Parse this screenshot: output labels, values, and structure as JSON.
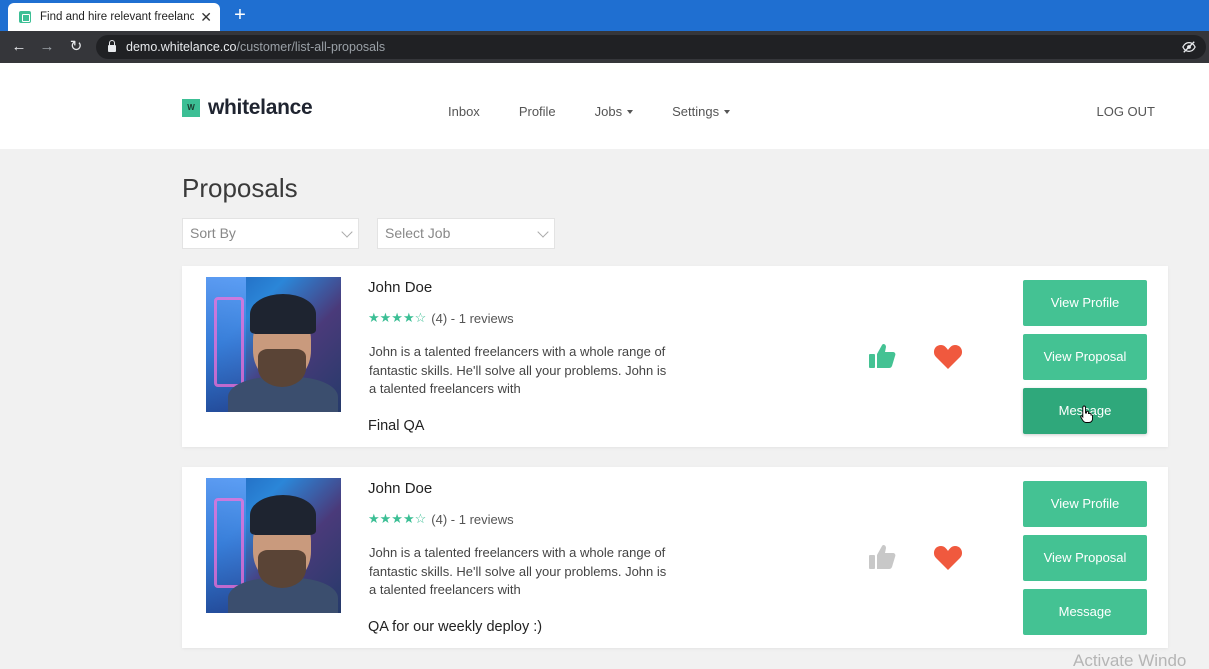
{
  "browser": {
    "tab_title": "Find and hire relevant freelancers",
    "url_host": "demo.whitelance.co",
    "url_path": "/customer/list-all-proposals"
  },
  "header": {
    "logo_mark": "W",
    "logo_text": "whitelance",
    "nav": [
      {
        "label": "Inbox"
      },
      {
        "label": "Profile"
      },
      {
        "label": "Jobs"
      },
      {
        "label": "Settings"
      }
    ],
    "logout": "LOG OUT"
  },
  "page": {
    "title": "Proposals",
    "sort_placeholder": "Sort By",
    "job_placeholder": "Select Job"
  },
  "proposals": [
    {
      "name": "John Doe",
      "rating_text": "(4) - 1 reviews",
      "stars": 4,
      "description": "John is a talented freelancers with a whole range of fantastic skills.  He'll solve all your problems.  John is a talented freelancers with",
      "job_title": "Final QA",
      "liked": true,
      "favorited": true,
      "view_profile": "View Profile",
      "view_proposal": "View Proposal",
      "message": "Message"
    },
    {
      "name": "John Doe",
      "rating_text": "(4) - 1 reviews",
      "stars": 4,
      "description": "John is a talented freelancers with a whole range of fantastic skills.  He'll solve all your problems.  John is a talented freelancers with",
      "job_title": "QA for our weekly deploy :)",
      "liked": false,
      "favorited": true,
      "view_profile": "View Profile",
      "view_proposal": "View Proposal",
      "message": "Message"
    }
  ],
  "overlay": {
    "activate_text": "Activate Windo"
  },
  "colors": {
    "accent": "#44c293",
    "heart": "#f0593e",
    "thumb_active": "#44c293",
    "thumb_inactive": "#c8c8c8"
  }
}
